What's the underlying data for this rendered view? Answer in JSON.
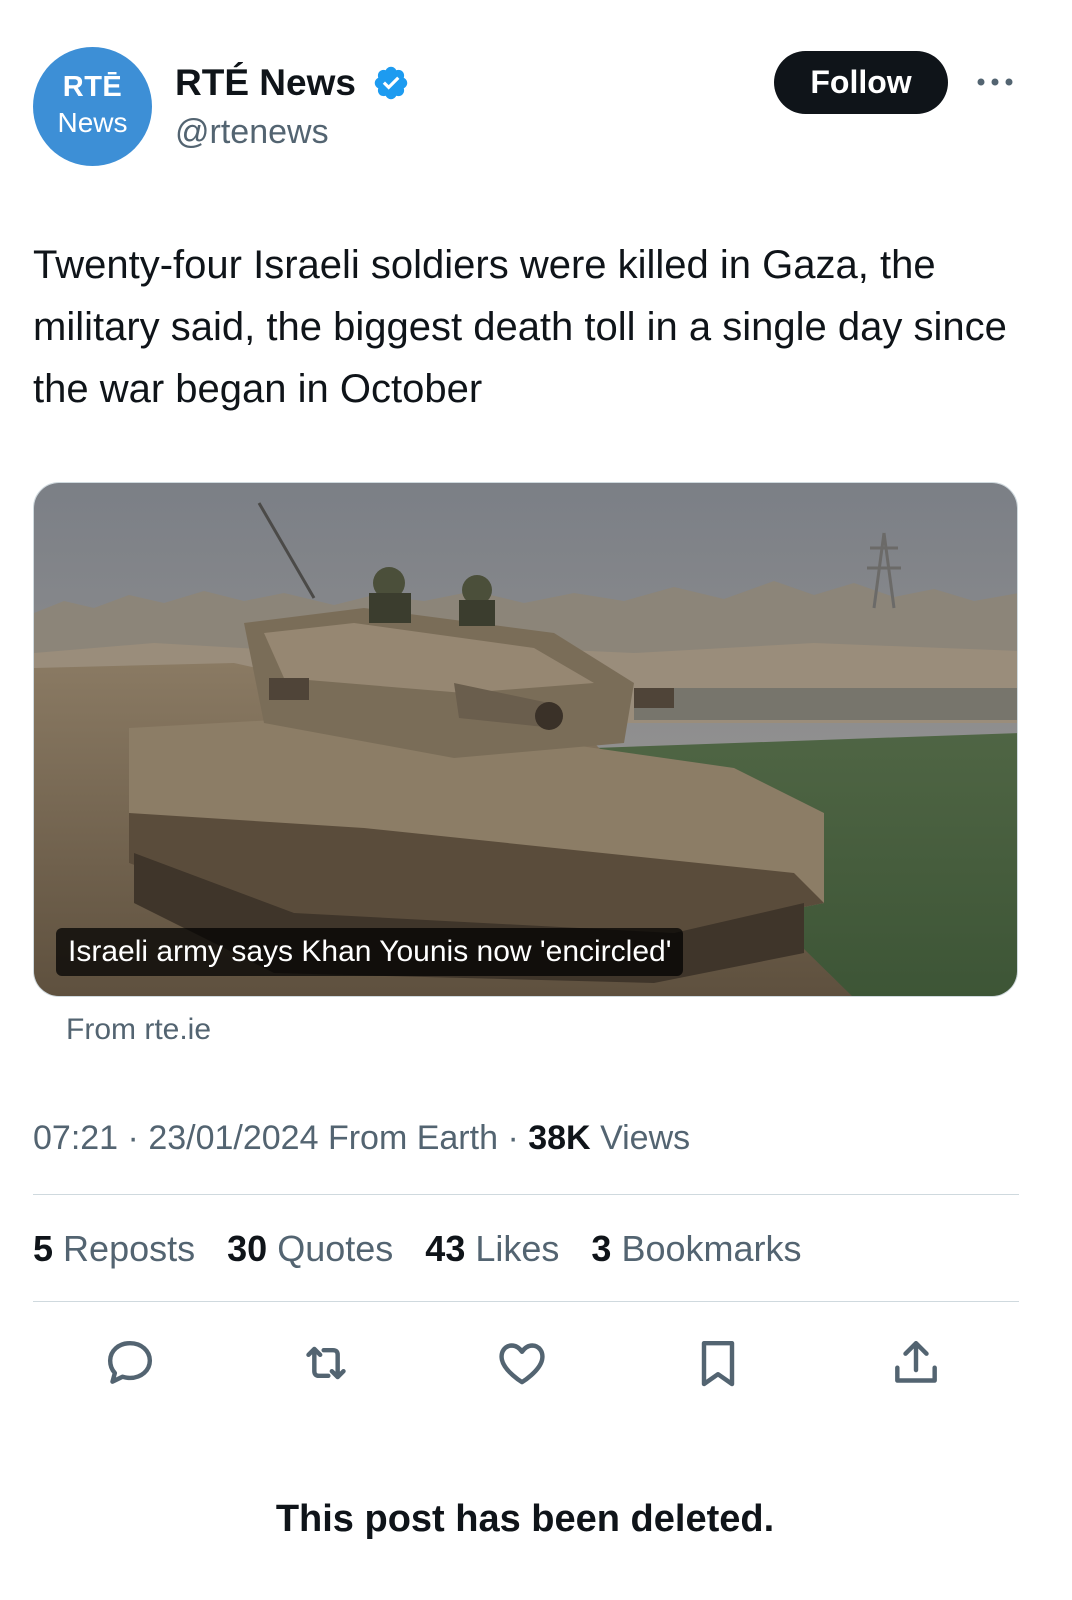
{
  "author": {
    "avatar_line1": "RTĒ",
    "avatar_line2": "News",
    "display_name": "RTÉ News",
    "handle": "@rtenews",
    "verified_icon": "verified-badge-icon",
    "verified_color": "#1d9bf0"
  },
  "header": {
    "follow_label": "Follow",
    "more_icon": "more-dots-icon"
  },
  "tweet": {
    "text": "Twenty-four Israeli soldiers were killed in Gaza, the military said, the biggest death toll in a single day since the war began in October"
  },
  "card": {
    "image_desc": "tank-photo",
    "caption": "Israeli army says Khan Younis now 'encircled'",
    "source": "From rte.ie"
  },
  "meta": {
    "time": "07:21",
    "date": "23/01/2024",
    "origin": "From Earth",
    "views_count": "38K",
    "views_label": "Views"
  },
  "stats": [
    {
      "count": "5",
      "label": "Reposts"
    },
    {
      "count": "30",
      "label": "Quotes"
    },
    {
      "count": "43",
      "label": "Likes"
    },
    {
      "count": "3",
      "label": "Bookmarks"
    }
  ],
  "actions": [
    "reply-icon",
    "repost-icon",
    "like-icon",
    "bookmark-icon",
    "share-icon"
  ],
  "notice": {
    "text": "This post has been deleted."
  },
  "colors": {
    "text_primary": "#0f1419",
    "text_secondary": "#536471",
    "divider": "#cfd9de",
    "avatar_bg": "#3d8fd6"
  }
}
